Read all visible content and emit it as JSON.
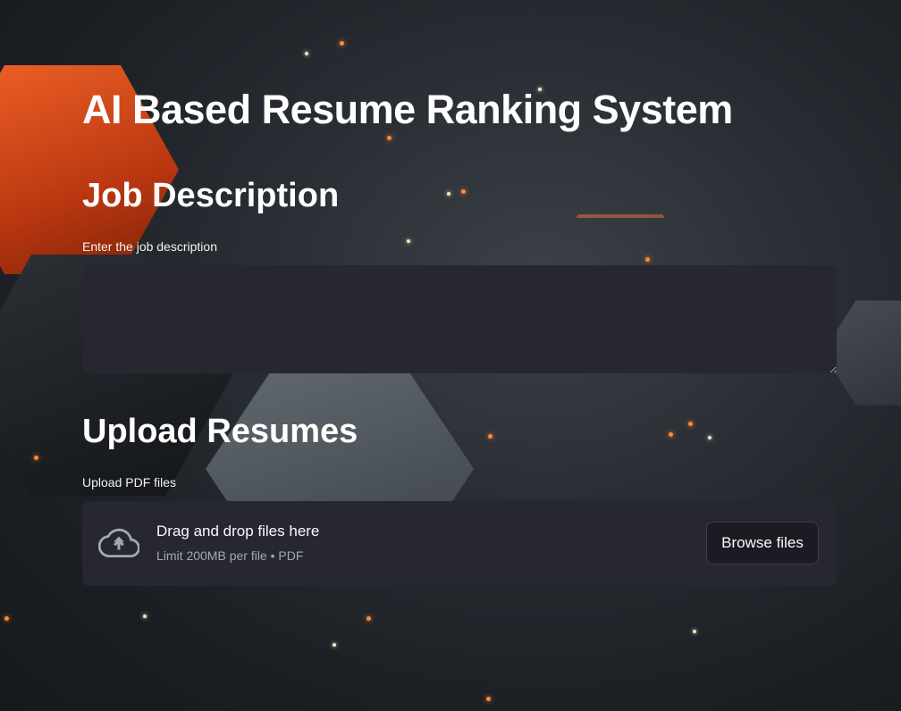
{
  "page": {
    "title": "AI Based Resume Ranking System"
  },
  "job_section": {
    "heading": "Job Description",
    "input_label": "Enter the job description",
    "input_value": ""
  },
  "upload_section": {
    "heading": "Upload Resumes",
    "input_label": "Upload PDF files",
    "dropzone_text": "Drag and drop files here",
    "dropzone_limit": "Limit 200MB per file • PDF",
    "browse_label": "Browse files",
    "icon": "cloud-upload-icon"
  },
  "colors": {
    "background": "#1f2328",
    "widget_bg": "#262730",
    "text": "#fafafa",
    "muted_text": "#a3a8b4",
    "accent": "#ff6a2a"
  }
}
